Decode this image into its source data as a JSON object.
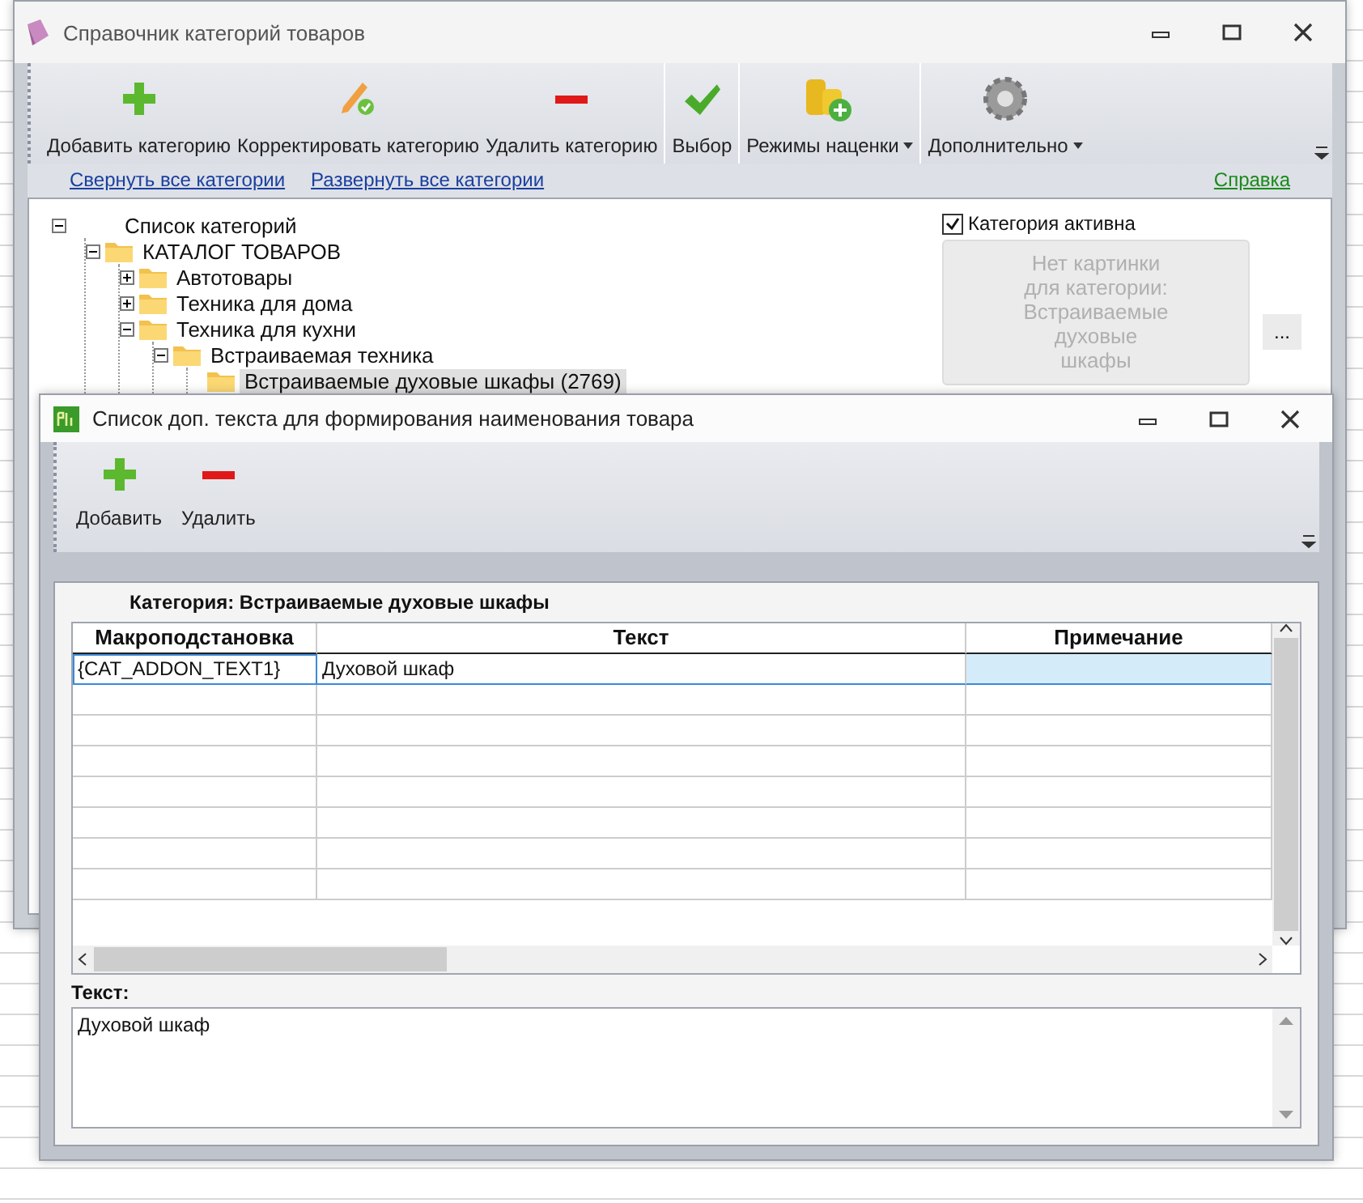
{
  "main_window": {
    "title": "Справочник категорий товаров",
    "toolbar_groups": [
      [
        {
          "label": "Добавить категорию",
          "kind": "add",
          "dropdown": false
        },
        {
          "label": "Корректировать категорию",
          "kind": "edit",
          "dropdown": false
        },
        {
          "label": "Удалить категорию",
          "kind": "remove",
          "dropdown": false
        }
      ],
      [
        {
          "label": "Выбор",
          "kind": "check",
          "dropdown": false
        }
      ],
      [
        {
          "label": "Режимы наценки",
          "kind": "coins",
          "dropdown": true
        }
      ],
      [
        {
          "label": "Дополнительно",
          "kind": "gear",
          "dropdown": true
        }
      ]
    ],
    "links": [
      "Свернуть все категории",
      "Развернуть все категории"
    ],
    "help_link": "Справка",
    "tree": [
      {
        "label": "Список категорий",
        "kind": "root",
        "expanded": true,
        "selected": false,
        "children": [
          {
            "label": "КАТАЛОГ ТОВАРОВ",
            "kind": "folder",
            "expanded": true,
            "selected": false,
            "children": [
              {
                "label": "Автотовары",
                "kind": "folder",
                "expanded": false,
                "selected": false
              },
              {
                "label": "Техника для дома",
                "kind": "folder",
                "expanded": false,
                "selected": false
              },
              {
                "label": "Техника для кухни",
                "kind": "folder",
                "expanded": true,
                "selected": false,
                "children": [
                  {
                    "label": "Встраиваемая техника",
                    "kind": "folder",
                    "expanded": true,
                    "selected": false,
                    "children": [
                      {
                        "label": "Встраиваемые духовые шкафы (2769)",
                        "kind": "folder",
                        "selected": true
                      }
                    ]
                  }
                ]
              }
            ]
          }
        ]
      }
    ],
    "category_active": {
      "label": "Категория активна",
      "checked": true
    },
    "picture_placeholder": "Нет картинки для категории: Встраиваемые духовые шкафы",
    "browse_button": "..."
  },
  "dialog": {
    "title": "Список доп. текста для формирования наименования товара",
    "toolbar": [
      {
        "label": "Добавить",
        "kind": "add"
      },
      {
        "label": "Удалить",
        "kind": "remove"
      }
    ],
    "category_label": "Категория: Встраиваемые духовые шкафы",
    "columns": [
      "Макроподстановка",
      "Текст",
      "Примечание"
    ],
    "rows": [
      {
        "cells": [
          "{CAT_ADDON_TEXT1}",
          "Духовой шкаф",
          ""
        ],
        "selected": true
      }
    ],
    "text_label": "Текст:",
    "text_value": "Духовой шкаф"
  }
}
